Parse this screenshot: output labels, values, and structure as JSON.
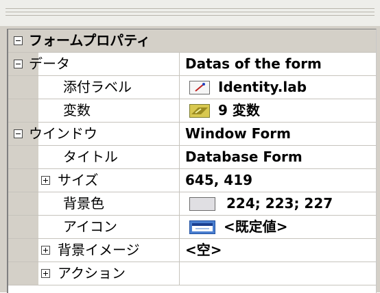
{
  "grid": {
    "category_form": "フォームプロパティ",
    "rows": [
      {
        "name": "データ",
        "value": "Datas of the form"
      },
      {
        "name": "添付ラベル",
        "value": "Identity.lab"
      },
      {
        "name": "変数",
        "value": "9 変数"
      },
      {
        "name": "ウインドウ",
        "value": "Window Form"
      },
      {
        "name": "タイトル",
        "value": "Database Form"
      },
      {
        "name": "サイズ",
        "value": "645, 419"
      },
      {
        "name": "背景色",
        "value": "224; 223; 227"
      },
      {
        "name": "アイコン",
        "value": "<既定値>"
      },
      {
        "name": "背景イメージ",
        "value": "<空>"
      },
      {
        "name": "アクション",
        "value": ""
      }
    ]
  },
  "colors": {
    "background_color_value": "#e0dfe3",
    "panel_gray": "#d4d0c8"
  },
  "icons": {
    "attached_label": "label-file-icon",
    "variables": "variables-icon",
    "background_color": "color-swatch-icon",
    "icon_property": "window-icon"
  }
}
